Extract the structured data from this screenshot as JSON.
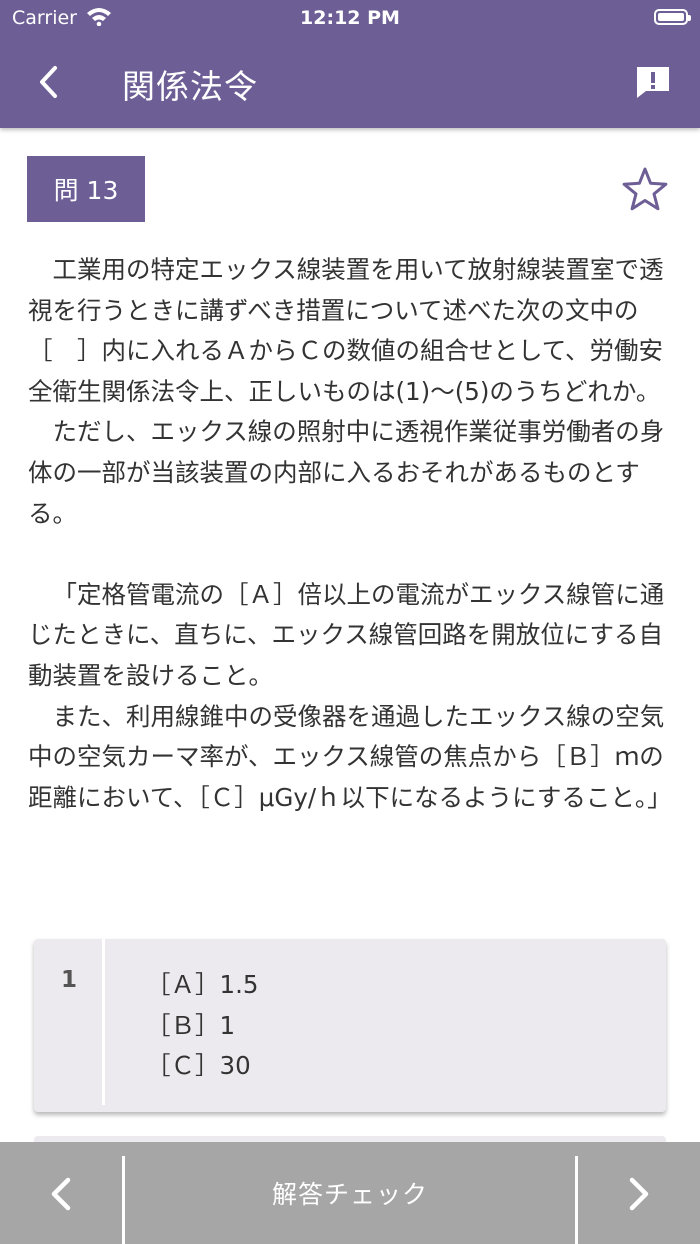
{
  "status_bar": {
    "carrier": "Carrier",
    "time": "12:12 PM"
  },
  "nav": {
    "title": "関係法令"
  },
  "question": {
    "badge": "問 13",
    "paragraphs": [
      "工業用の特定エックス線装置を用いて放射線装置室で透視を行うときに講ずべき措置について述べた次の文中の［　］内に入れるＡからＣの数値の組合せとして、労働安全衛生関係法令上、正しいものは(1)～(5)のうちどれか。",
      "ただし、エックス線の照射中に透視作業従事労働者の身体の一部が当該装置の内部に入るおそれがあるものとする。",
      "「定格管電流の［Ａ］倍以上の電流がエックス線管に通じたときに、直ちに、エックス線管回路を開放位にする自動装置を設けること。",
      "また、利用線錐中の受像器を通過したエックス線の空気中の空気カーマ率が、エックス線管の焦点から［Ｂ］ｍの距離において、［Ｃ］μGy/ｈ以下になるようにすること。」"
    ]
  },
  "choices": [
    {
      "number": "1",
      "lines": [
        "［Ａ］1.5",
        "［Ｂ］1",
        "［Ｃ］30"
      ]
    }
  ],
  "bottom_bar": {
    "check_label": "解答チェック"
  },
  "colors": {
    "primary": "#6d5f96",
    "bottom_bar": "#a6a6a6",
    "card": "#eceaee"
  },
  "icons": {
    "back": "chevron-left-icon",
    "report": "report-bubble-icon",
    "favorite": "star-outline-icon",
    "prev": "chevron-left-icon",
    "next": "chevron-right-icon"
  }
}
